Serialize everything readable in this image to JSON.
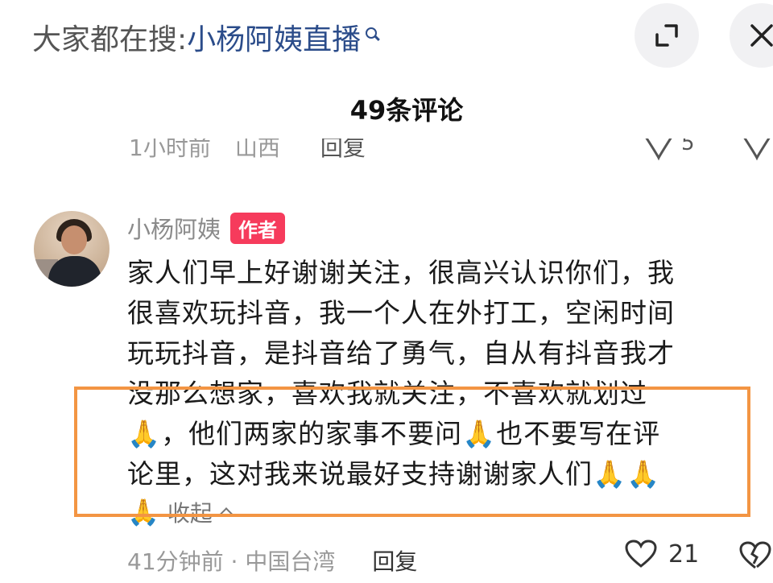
{
  "search": {
    "prefix": "大家都在搜:",
    "query": "小杨阿姨直播"
  },
  "header": {
    "comment_count_label": "49条评论"
  },
  "previous_comment": {
    "meta": [
      "1小时前",
      "山西"
    ],
    "reply_label": "回复",
    "like_count": "5"
  },
  "comment": {
    "author": "小杨阿姨",
    "badge": "作者",
    "text_lines": [
      "家人们早上好谢谢关注，很高兴认识你们，我",
      "很喜欢玩抖音，我一个人在外打工，空闲时间",
      "玩玩抖音，是抖音给了勇气，自从有抖音我才",
      "没那么想家，喜欢我就关注，不喜欢就划过",
      "🙏，他们两家的家事不要问🙏也不要写在评",
      "论里，这对我来说最好支持谢谢家人们🙏🙏",
      "🙏"
    ],
    "collapse_label": "收起",
    "time_location": "41分钟前 · 中国台湾",
    "reply_label": "回复",
    "like_count": "21"
  },
  "colors": {
    "badge": "#f63b5c",
    "highlight_border": "#f39543",
    "search_link": "#2b4c8a"
  },
  "icons": [
    "search-icon",
    "expand-icon",
    "close-icon",
    "heart-icon",
    "broken-heart-icon",
    "chevron-up-icon"
  ]
}
